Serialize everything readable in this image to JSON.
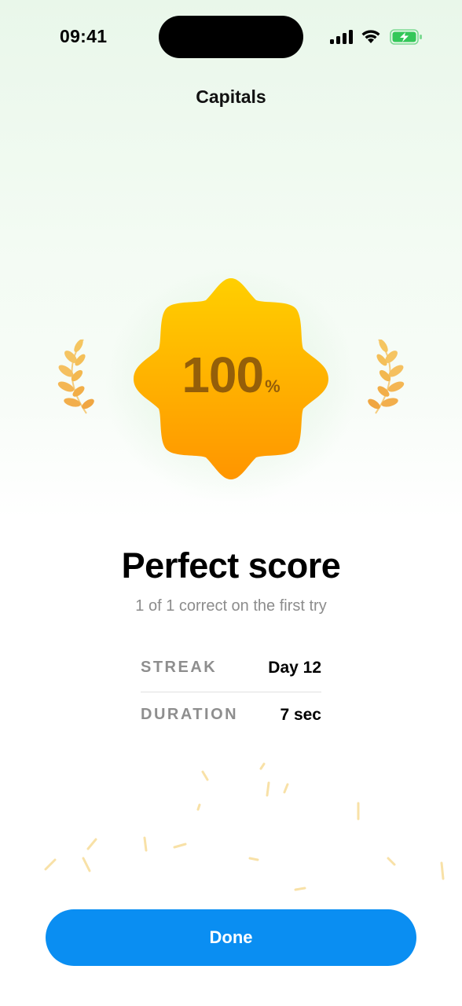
{
  "status_bar": {
    "time": "09:41",
    "icons": [
      "cellular-signal-icon",
      "wifi-icon",
      "battery-charging-icon"
    ],
    "battery_color": "#34c759"
  },
  "nav": {
    "title": "Capitals"
  },
  "result": {
    "score": "100",
    "score_unit": "%",
    "headline": "Perfect score",
    "subline": "1 of 1 correct on the first try"
  },
  "stats": [
    {
      "label": "STREAK",
      "value": "Day 12"
    },
    {
      "label": "DURATION",
      "value": "7 sec"
    }
  ],
  "actions": {
    "done_label": "Done"
  },
  "colors": {
    "accent": "#0a8ef2",
    "badge_top": "#ffcf00",
    "badge_bottom": "#ff9500",
    "laurel": "#f3b84a",
    "background_tint": "#e9f7ea"
  },
  "decorations": [
    "laurel-left-icon",
    "laurel-right-icon",
    "confetti"
  ]
}
